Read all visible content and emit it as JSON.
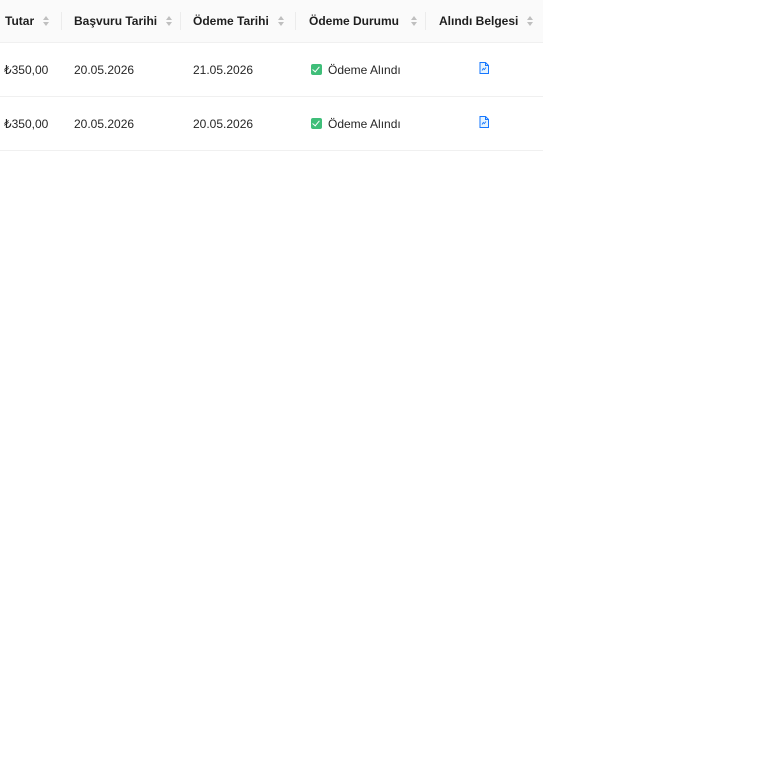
{
  "table": {
    "columns": [
      {
        "key": "amount",
        "label": "Tutar"
      },
      {
        "key": "application_date",
        "label": "Başvuru Tarihi"
      },
      {
        "key": "payment_date",
        "label": "Ödeme Tarihi"
      },
      {
        "key": "payment_status",
        "label": "Ödeme Durumu"
      },
      {
        "key": "receipt",
        "label": "Alındı Belgesi"
      }
    ],
    "rows": [
      {
        "amount": "₺350,00",
        "application_date": "20.05.2026",
        "payment_date": "21.05.2026",
        "payment_status": "Ödeme Alındı",
        "status_icon": "check-square-icon",
        "receipt_icon": "file-pdf-icon"
      },
      {
        "amount": "₺350,00",
        "application_date": "20.05.2026",
        "payment_date": "20.05.2026",
        "payment_status": "Ödeme Alındı",
        "status_icon": "check-square-icon",
        "receipt_icon": "file-pdf-icon"
      }
    ]
  },
  "colors": {
    "header_bg": "#fafafa",
    "status_green": "#3fbe79",
    "icon_blue": "#1677ff",
    "border": "#f0f0f0"
  }
}
